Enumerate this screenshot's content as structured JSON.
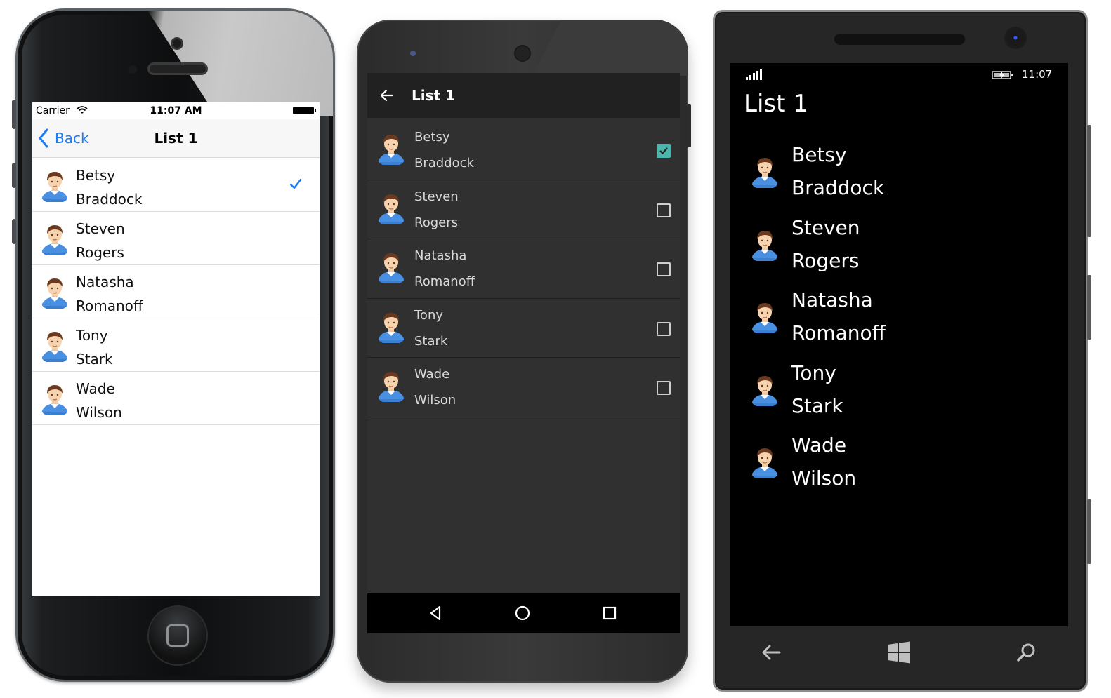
{
  "ios": {
    "status": {
      "carrier": "Carrier",
      "time": "11:07 AM"
    },
    "nav": {
      "back_label": "Back",
      "title": "List 1"
    },
    "items": [
      {
        "first": "Betsy",
        "last": "Braddock",
        "selected": true
      },
      {
        "first": "Steven",
        "last": "Rogers",
        "selected": false
      },
      {
        "first": "Natasha",
        "last": "Romanoff",
        "selected": false
      },
      {
        "first": "Tony",
        "last": "Stark",
        "selected": false
      },
      {
        "first": "Wade",
        "last": "Wilson",
        "selected": false
      }
    ],
    "colors": {
      "accent": "#1a7cf6"
    }
  },
  "android": {
    "appbar": {
      "title": "List 1"
    },
    "items": [
      {
        "first": "Betsy",
        "last": "Braddock",
        "checked": true
      },
      {
        "first": "Steven",
        "last": "Rogers",
        "checked": false
      },
      {
        "first": "Natasha",
        "last": "Romanoff",
        "checked": false
      },
      {
        "first": "Tony",
        "last": "Stark",
        "checked": false
      },
      {
        "first": "Wade",
        "last": "Wilson",
        "checked": false
      }
    ],
    "navbar": [
      "back-triangle-icon",
      "home-circle-icon",
      "recents-square-icon"
    ],
    "colors": {
      "accent": "#4db6ac",
      "background": "#303030",
      "appbar": "#212121"
    }
  },
  "windows": {
    "status": {
      "time": "11:07"
    },
    "title": "List 1",
    "items": [
      {
        "first": "Betsy",
        "last": "Braddock"
      },
      {
        "first": "Steven",
        "last": "Rogers"
      },
      {
        "first": "Natasha",
        "last": "Romanoff"
      },
      {
        "first": "Tony",
        "last": "Stark"
      },
      {
        "first": "Wade",
        "last": "Wilson"
      }
    ],
    "hardware_buttons": [
      "back-arrow-icon",
      "windows-logo-icon",
      "search-icon"
    ]
  }
}
